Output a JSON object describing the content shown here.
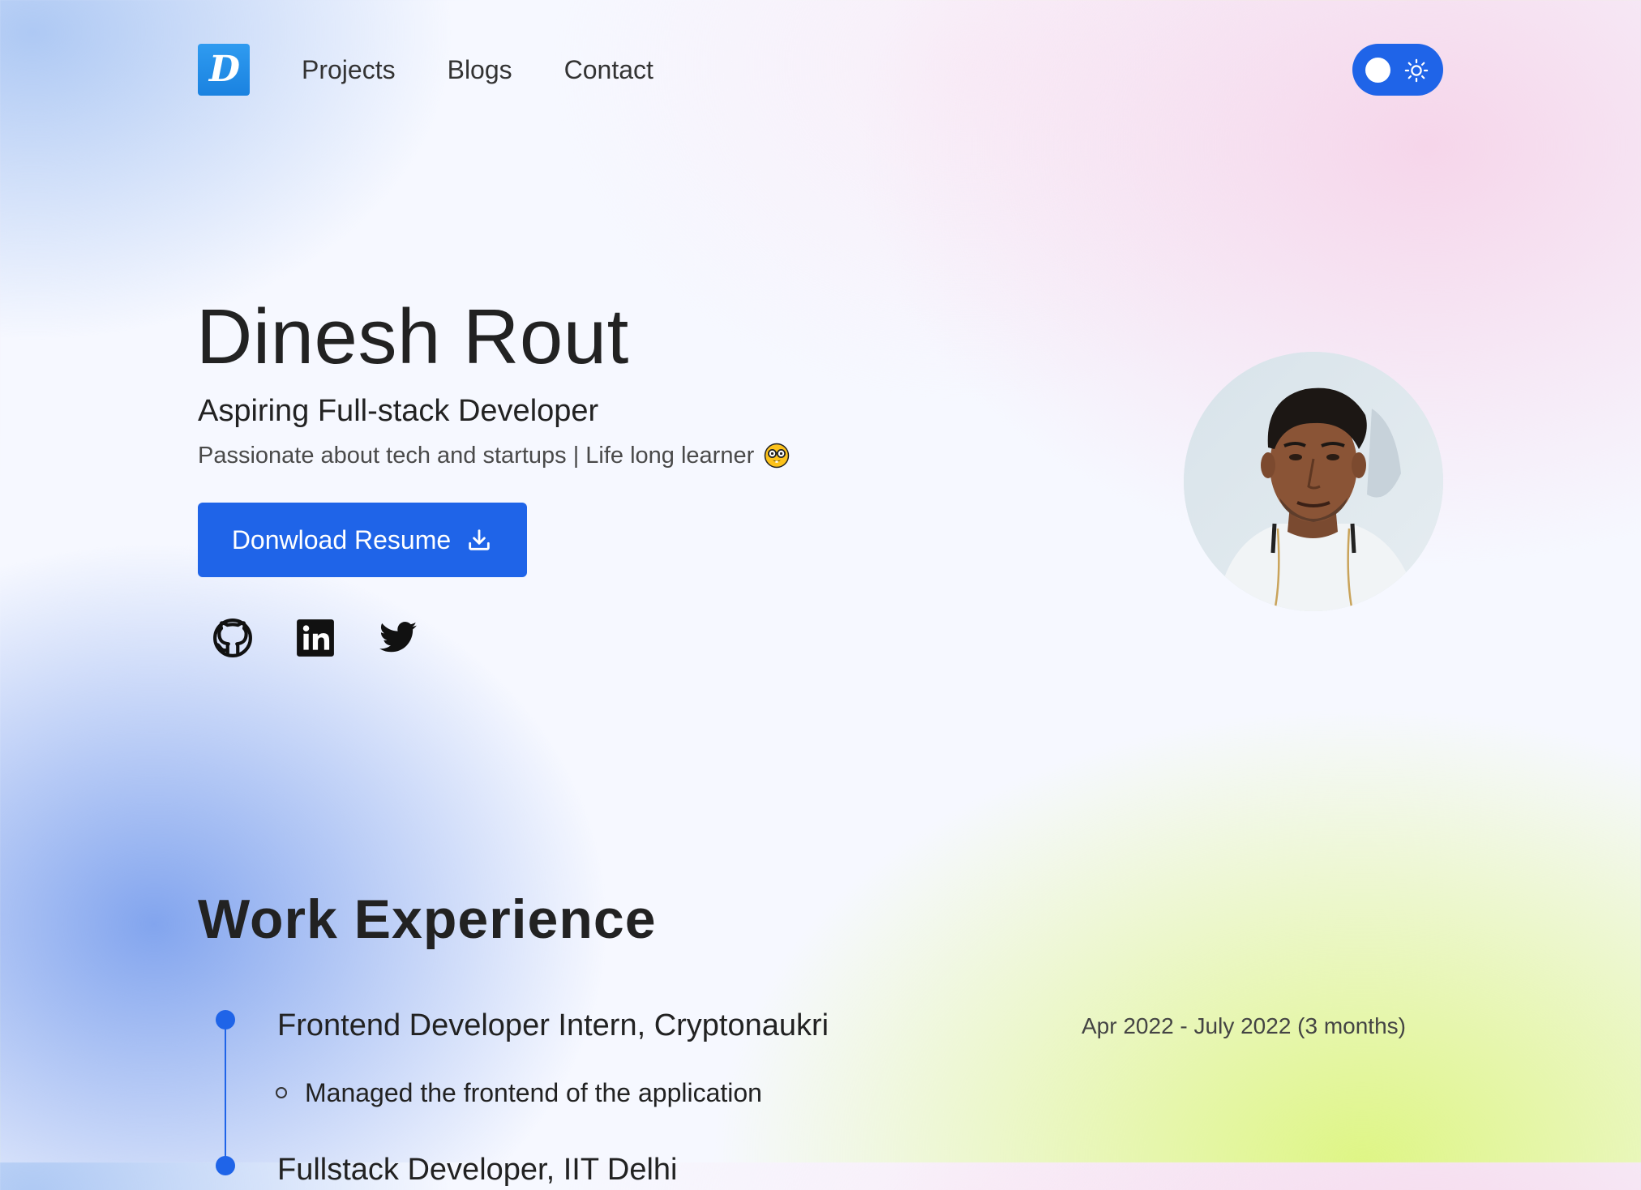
{
  "header": {
    "logo_letter": "D",
    "nav": [
      {
        "label": "Projects"
      },
      {
        "label": "Blogs"
      },
      {
        "label": "Contact"
      }
    ],
    "theme_toggle": {
      "state": "light",
      "icon": "sun-icon"
    }
  },
  "hero": {
    "name": "Dinesh Rout",
    "role": "Aspiring Full-stack Developer",
    "tagline": "Passionate about tech and startups | Life long learner",
    "tagline_emoji": "nerd-face-emoji",
    "resume_button": "Donwload Resume",
    "social": [
      {
        "icon": "github-icon"
      },
      {
        "icon": "linkedin-icon"
      },
      {
        "icon": "twitter-icon"
      }
    ]
  },
  "work": {
    "title": "Work Experience",
    "jobs": [
      {
        "title": "Frontend Developer Intern, Cryptonaukri",
        "dates": "Apr 2022 - July 2022 (3 months)",
        "bullets": [
          "Managed the frontend of the application"
        ]
      },
      {
        "title": "Fullstack Developer, IIT Delhi"
      }
    ]
  },
  "colors": {
    "accent": "#1f64e8",
    "logo": "#1a82e0",
    "text": "#222222"
  }
}
